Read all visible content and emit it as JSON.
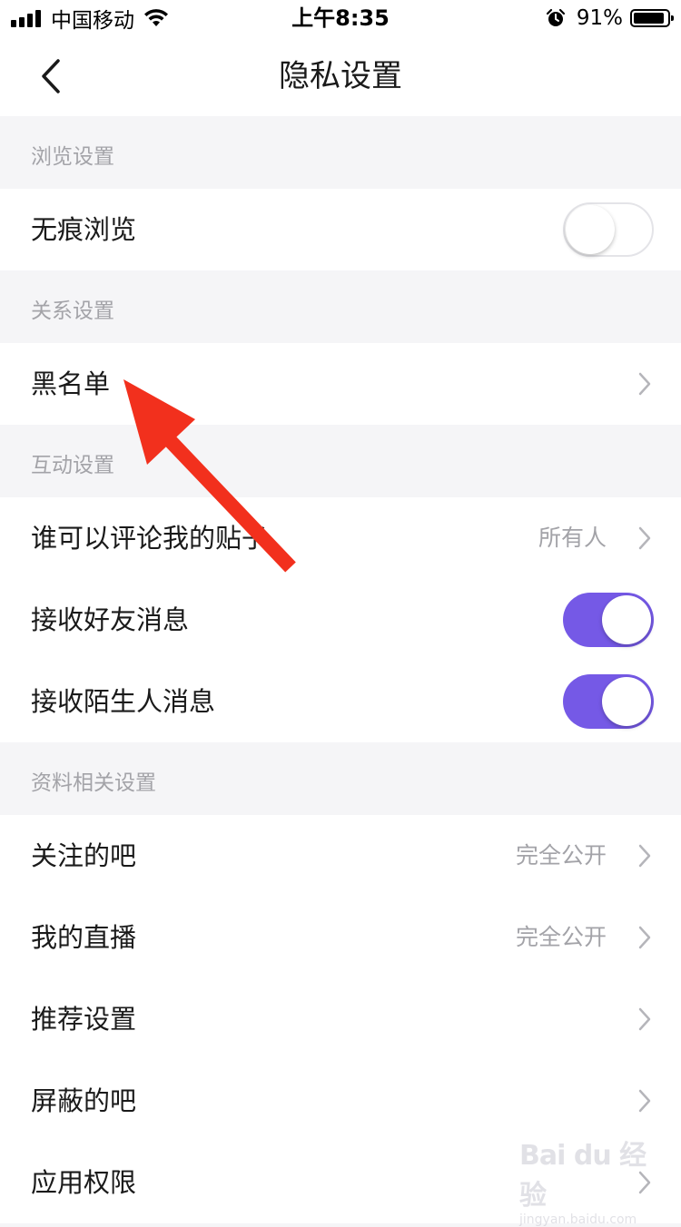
{
  "status_bar": {
    "carrier": "中国移动",
    "time": "上午8:35",
    "battery": "91%",
    "battery_level": 0.91,
    "icons": [
      "signal-icon",
      "wifi-icon",
      "alarm-icon",
      "battery-icon"
    ]
  },
  "nav": {
    "title": "隐私设置",
    "back_icon": "chevron-left-icon"
  },
  "sections": [
    {
      "header": "浏览设置",
      "rows": [
        {
          "label": "无痕浏览",
          "control": "toggle",
          "on": false
        }
      ]
    },
    {
      "header": "关系设置",
      "rows": [
        {
          "label": "黑名单",
          "control": "chevron"
        }
      ]
    },
    {
      "header": "互动设置",
      "rows": [
        {
          "label": "谁可以评论我的贴子",
          "value": "所有人",
          "control": "chevron"
        },
        {
          "label": "接收好友消息",
          "control": "toggle",
          "on": true
        },
        {
          "label": "接收陌生人消息",
          "control": "toggle",
          "on": true
        }
      ]
    },
    {
      "header": "资料相关设置",
      "rows": [
        {
          "label": "关注的吧",
          "value": "完全公开",
          "control": "chevron"
        },
        {
          "label": "我的直播",
          "value": "完全公开",
          "control": "chevron"
        },
        {
          "label": "推荐设置",
          "control": "chevron"
        },
        {
          "label": "屏蔽的吧",
          "control": "chevron"
        },
        {
          "label": "应用权限",
          "control": "chevron"
        }
      ]
    }
  ],
  "watermark": {
    "logo": "Bai du 经验",
    "url": "jingyan.baidu.com"
  },
  "colors": {
    "accent": "#7559e6",
    "annotation_arrow": "#f2301d",
    "background": "#f5f5f7",
    "secondary_text": "#a3a3a8"
  }
}
